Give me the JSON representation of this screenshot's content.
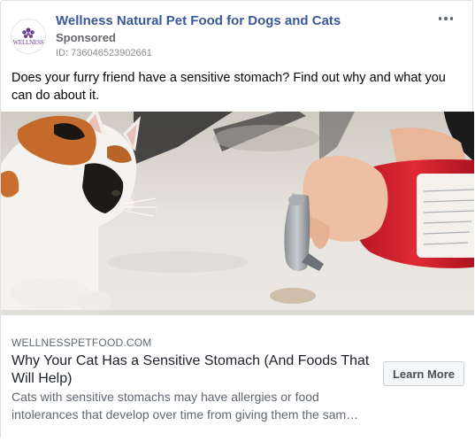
{
  "post": {
    "page_name": "Wellness Natural Pet Food for Dogs and Cats",
    "sponsored_label": "Sponsored",
    "ad_id": "ID: 736046523902661",
    "more_icon": "more-horizontal-icon",
    "logo_text": "WELLNESS",
    "body_text": "Does your furry friend have a sensitive stomach? Find out why and what you can do about it."
  },
  "link_preview": {
    "domain": "WELLNESSPETFOOD.COM",
    "headline": "Why Your Cat Has a Sensitive Stomach (And Foods That Will Help)",
    "description": "Cats with sensitive stomachs may have allergies or food intolerances that develop over time from giving them the sam…",
    "cta_label": "Learn More"
  },
  "colors": {
    "page_name": "#385898",
    "secondary_text": "#65676b",
    "logo_purple": "#6b3f8f",
    "spray_bottle_red": "#d8232e"
  }
}
